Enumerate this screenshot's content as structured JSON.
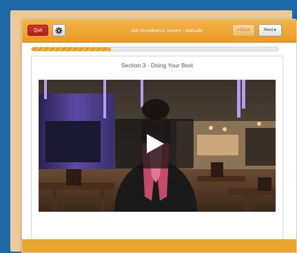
{
  "toolbar": {
    "quit_label": "Quit",
    "title": "Job Readiness Series - Attitude",
    "back_label": "◂ Back",
    "next_label": "Next ▸",
    "settings_icon": "gear-icon"
  },
  "progress": {
    "fraction": 0.32
  },
  "content": {
    "section_title": "Section 3 - Doing Your Best"
  },
  "video": {
    "play_icon": "play-icon"
  },
  "colors": {
    "page_bg": "#1d6aa6",
    "frame": "#eecb96",
    "toolbar": "#efa630",
    "quit": "#c9251f",
    "progress": "#e8a52f"
  }
}
